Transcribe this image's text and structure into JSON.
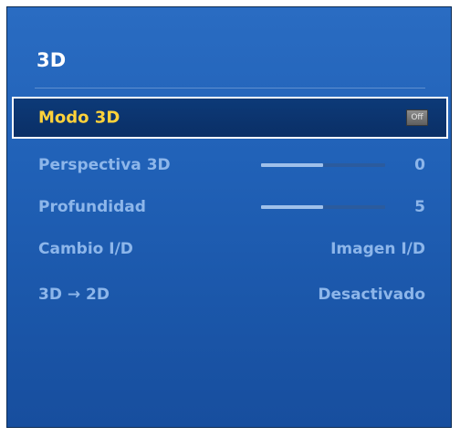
{
  "menu": {
    "title": "3D",
    "items": [
      {
        "label": "Modo 3D",
        "value": "Off",
        "type": "badge",
        "selected": true
      },
      {
        "label": "Perspectiva 3D",
        "value": "0",
        "type": "slider",
        "level": 0.5
      },
      {
        "label": "Profundidad",
        "value": "5",
        "type": "slider",
        "level": 0.5
      },
      {
        "label": "Cambio I/D",
        "value": "Imagen I/D",
        "type": "text"
      },
      {
        "label": "3D → 2D",
        "value": "Desactivado",
        "type": "text"
      }
    ]
  },
  "colors": {
    "panel_bg": "#2162b8",
    "selected_bg": "#0b3370",
    "selected_label": "#ffd23a",
    "item_text": "#8db6ea",
    "slider_fill": "#9fc0ea"
  }
}
